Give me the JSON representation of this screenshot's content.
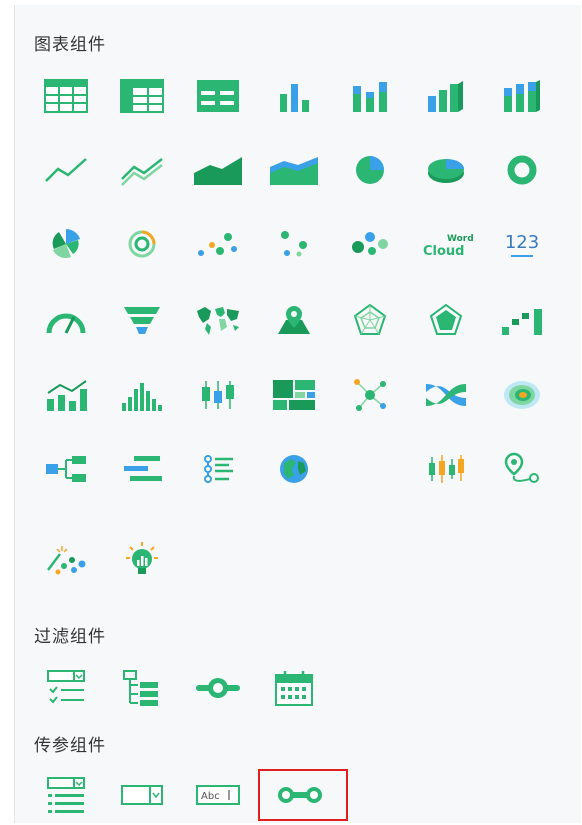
{
  "sections": {
    "chart": {
      "title": "图表组件"
    },
    "filter": {
      "title": "过滤组件"
    },
    "param": {
      "title": "传参组件"
    }
  },
  "icons": {
    "wordcloud": {
      "small": "Word",
      "big": "Cloud"
    },
    "number": {
      "text": "123"
    },
    "abc": {
      "text": "Abc"
    }
  },
  "colors": {
    "green": "#2bb673",
    "dark_green": "#1a9a5a",
    "light_green": "#7fd6a0",
    "blue": "#3aa0e8",
    "orange": "#f5a623",
    "highlight": "#e02020"
  }
}
